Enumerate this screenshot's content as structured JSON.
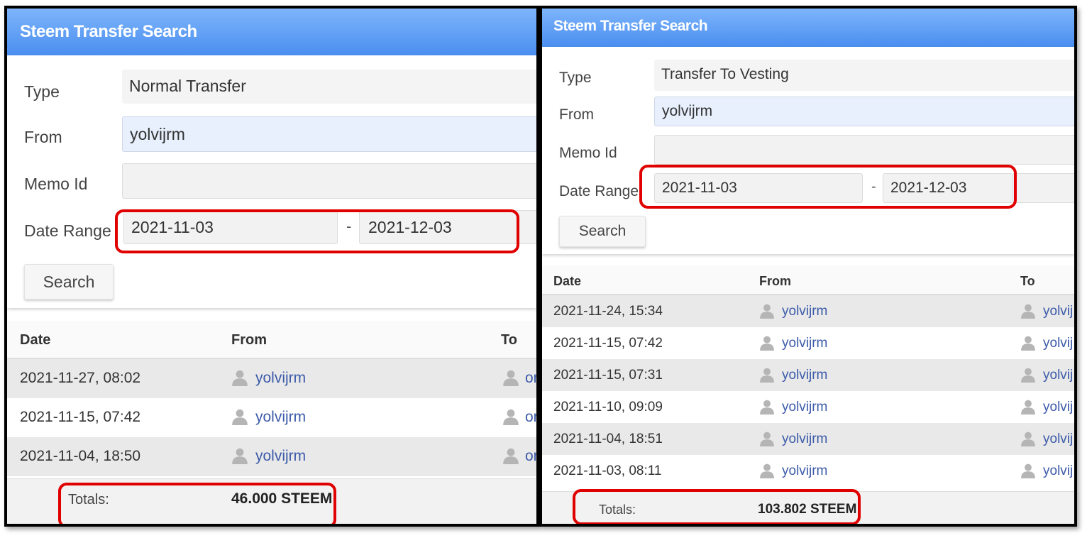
{
  "left": {
    "title": "Steem Transfer Search",
    "form": {
      "type_label": "Type",
      "type_value": "Normal Transfer",
      "from_label": "From",
      "from_value": "yolvijrm",
      "memo_label": "Memo Id",
      "memo_value": "",
      "date_label": "Date Range",
      "date_start": "2021-11-03",
      "date_sep": "-",
      "date_end": "2021-12-03",
      "search_label": "Search"
    },
    "table": {
      "headers": [
        "Date",
        "From",
        "To"
      ],
      "rows": [
        {
          "date": "2021-11-27, 08:02",
          "from": "yolvijrm",
          "to": "or"
        },
        {
          "date": "2021-11-15, 07:42",
          "from": "yolvijrm",
          "to": "or"
        },
        {
          "date": "2021-11-04, 18:50",
          "from": "yolvijrm",
          "to": "or"
        }
      ],
      "totals_label": "Totals:",
      "totals_value": "46.000 STEEM"
    }
  },
  "right": {
    "title": "Steem Transfer Search",
    "form": {
      "type_label": "Type",
      "type_value": "Transfer To Vesting",
      "from_label": "From",
      "from_value": "yolvijrm",
      "memo_label": "Memo Id",
      "memo_value": "",
      "date_label": "Date Range",
      "date_start": "2021-11-03",
      "date_sep": "-",
      "date_end": "2021-12-03",
      "search_label": "Search"
    },
    "table": {
      "headers": [
        "Date",
        "From",
        "To"
      ],
      "rows": [
        {
          "date": "2021-11-24, 15:34",
          "from": "yolvijrm",
          "to": "yolvij"
        },
        {
          "date": "2021-11-15, 07:42",
          "from": "yolvijrm",
          "to": "yolvij"
        },
        {
          "date": "2021-11-15, 07:31",
          "from": "yolvijrm",
          "to": "yolvij"
        },
        {
          "date": "2021-11-10, 09:09",
          "from": "yolvijrm",
          "to": "yolvij"
        },
        {
          "date": "2021-11-04, 18:51",
          "from": "yolvijrm",
          "to": "yolvij"
        },
        {
          "date": "2021-11-03, 08:11",
          "from": "yolvijrm",
          "to": "yolvij"
        }
      ],
      "totals_label": "Totals:",
      "totals_value": "103.802 STEEM"
    }
  },
  "colors": {
    "title_bar": "#5a9af3",
    "highlight": "#e00000",
    "link": "#3b5aa8",
    "alt_row": "#e9e9e9"
  },
  "icons": {
    "user": "user-silhouette-icon"
  }
}
